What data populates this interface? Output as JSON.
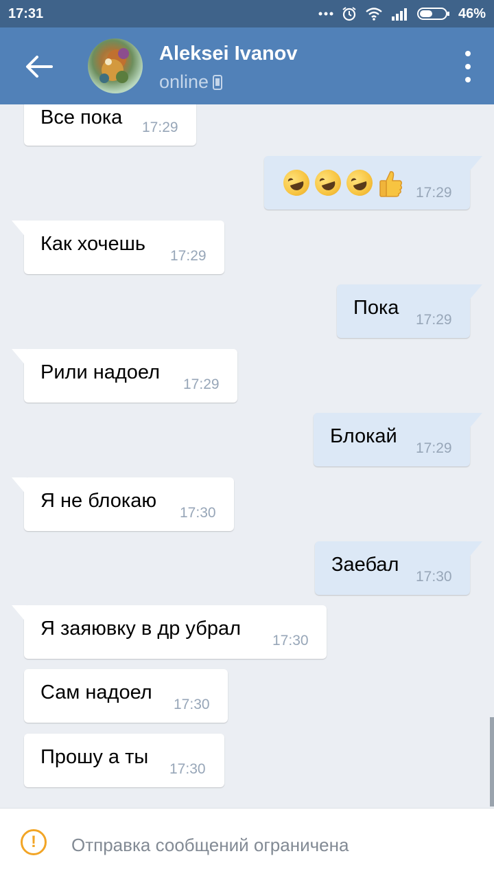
{
  "status_bar": {
    "time": "17:31",
    "battery": "46%"
  },
  "header": {
    "name": "Aleksei Ivanov",
    "status": "online"
  },
  "messages": [
    {
      "dir": "in",
      "text": "Все пока",
      "time": "17:29"
    },
    {
      "dir": "out",
      "text": "",
      "emoji": [
        "rolling-on-floor-laughing",
        "rolling-on-floor-laughing",
        "rolling-on-floor-laughing",
        "thumbs-up"
      ],
      "time": "17:29"
    },
    {
      "dir": "in",
      "text": "Как хочешь",
      "time": "17:29"
    },
    {
      "dir": "out",
      "text": "Пока",
      "time": "17:29"
    },
    {
      "dir": "in",
      "text": "Рили надоел",
      "time": "17:29"
    },
    {
      "dir": "out",
      "text": "Блокай",
      "time": "17:29"
    },
    {
      "dir": "in",
      "text": "Я не блокаю",
      "time": "17:30"
    },
    {
      "dir": "out",
      "text": "Заебал",
      "time": "17:30"
    },
    {
      "dir": "in",
      "text": "Я заяювку в др убрал",
      "time": "17:30"
    },
    {
      "dir": "in",
      "text": "Сам надоел",
      "time": "17:30"
    },
    {
      "dir": "in",
      "text": "Прошу а ты",
      "time": "17:30"
    }
  ],
  "footer": {
    "notice": "Отправка сообщений ограничена"
  },
  "colors": {
    "header": "#5181b8",
    "status_bar": "#3f638a",
    "outgoing_bubble": "#dce8f6",
    "incoming_bubble": "#ffffff",
    "warning": "#f2a526"
  }
}
